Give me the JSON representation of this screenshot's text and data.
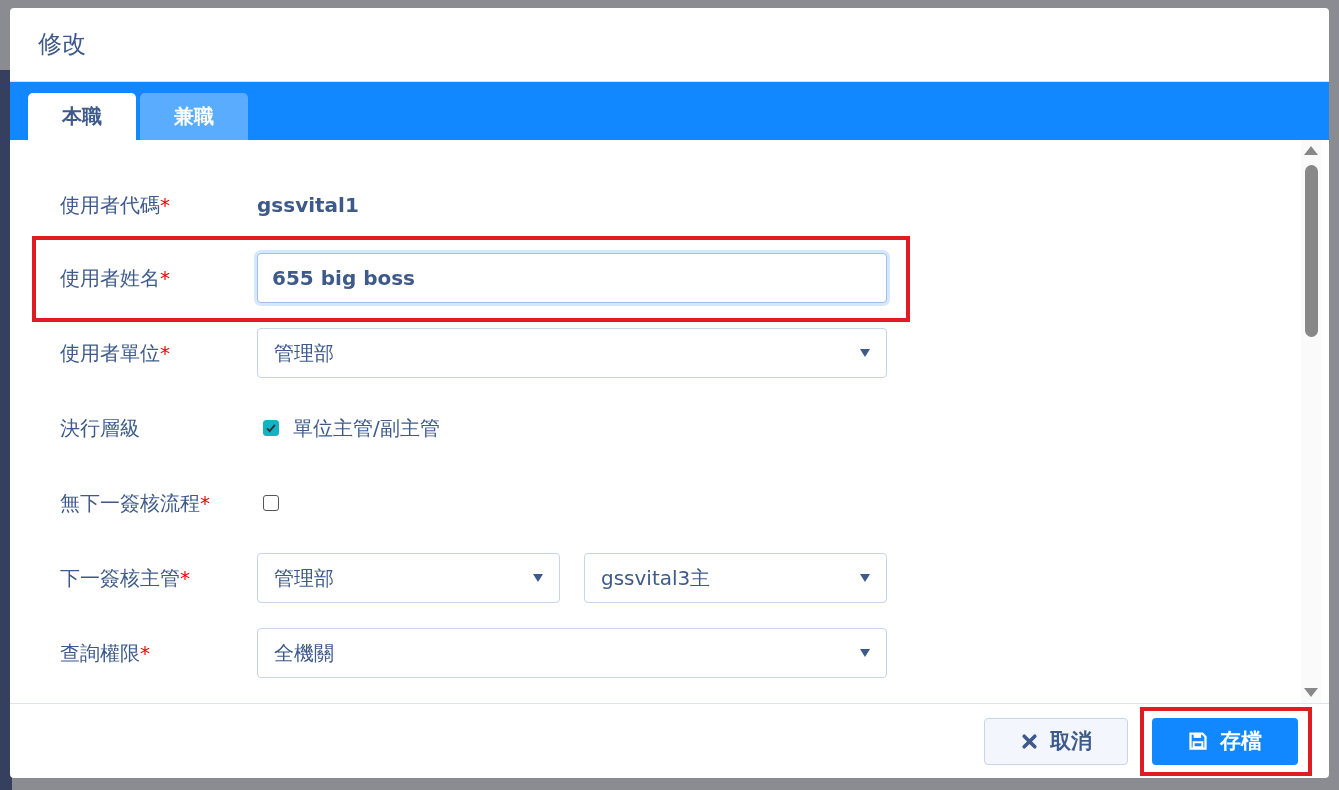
{
  "dialog": {
    "title": "修改"
  },
  "tabs": [
    {
      "label": "本職",
      "selected": true
    },
    {
      "label": "兼職",
      "selected": false
    }
  ],
  "fields": [
    {
      "kind": "text",
      "label": "使用者代碼",
      "required_mark": "*",
      "value": "gssvital1"
    },
    {
      "kind": "input",
      "label": "使用者姓名",
      "required_mark": "*",
      "value": "655 big boss",
      "highlighted": true
    },
    {
      "kind": "select",
      "label": "使用者單位",
      "required_mark": "*",
      "value": "管理部"
    },
    {
      "kind": "checkbox",
      "label": "決行層級",
      "checked": true,
      "option": "單位主管/副主管"
    },
    {
      "kind": "checkbox",
      "label": "無下一簽核流程",
      "required_mark": "*",
      "checked": false
    },
    {
      "kind": "select-pair",
      "label": "下一簽核主管",
      "required_mark": "*",
      "values": [
        "管理部",
        "gssvital3主"
      ]
    },
    {
      "kind": "select",
      "label": "查詢權限",
      "required_mark": "*",
      "value": "全機關"
    }
  ],
  "buttons": [
    {
      "kind": "cancel",
      "label": "取消"
    },
    {
      "kind": "save",
      "label": "存檔",
      "highlighted": true
    }
  ]
}
